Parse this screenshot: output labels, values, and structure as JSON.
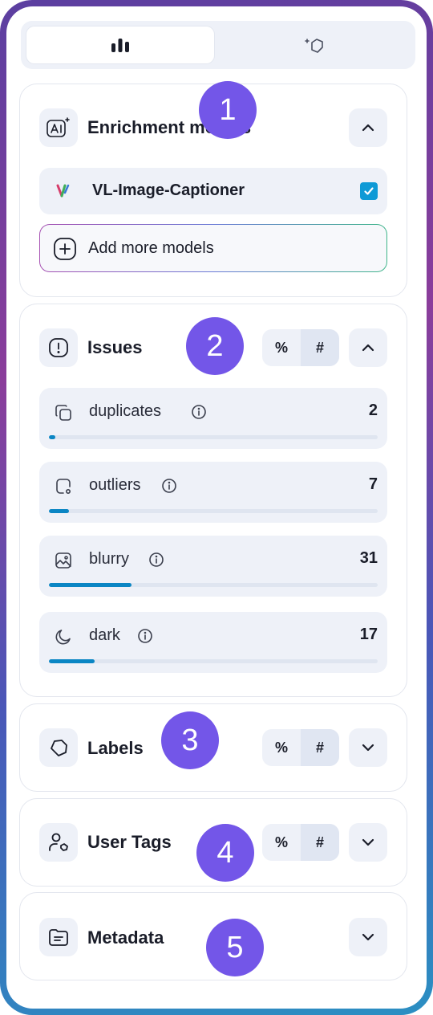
{
  "tabs": [
    {
      "icon": "bar-chart-icon",
      "active": true
    },
    {
      "icon": "tag-plus-icon",
      "active": false
    }
  ],
  "enrichment": {
    "title": "Enrichment models",
    "icon": "ai-sparkle-icon",
    "model": {
      "name": "VL-Image-Captioner",
      "checked": true
    },
    "add_label": "Add more models"
  },
  "issues": {
    "title": "Issues",
    "toggle": [
      "%",
      "#"
    ],
    "items": [
      {
        "name": "duplicates",
        "count": "2",
        "fraction": 0.02,
        "icon": "duplicate-icon"
      },
      {
        "name": "outliers",
        "count": "7",
        "fraction": 0.06,
        "icon": "outlier-icon"
      },
      {
        "name": "blurry",
        "count": "31",
        "fraction": 0.25,
        "icon": "image-icon"
      },
      {
        "name": "dark",
        "count": "17",
        "fraction": 0.14,
        "icon": "moon-icon"
      }
    ]
  },
  "labels": {
    "title": "Labels",
    "toggle": [
      "%",
      "#"
    ]
  },
  "user_tags": {
    "title": "User Tags",
    "toggle": [
      "%",
      "#"
    ]
  },
  "metadata": {
    "title": "Metadata"
  },
  "badges": [
    "1",
    "2",
    "3",
    "4",
    "5"
  ],
  "colors": {
    "accent": "#7356e8",
    "progress": "#0b86c4",
    "checkbox": "#0e9ad6"
  }
}
